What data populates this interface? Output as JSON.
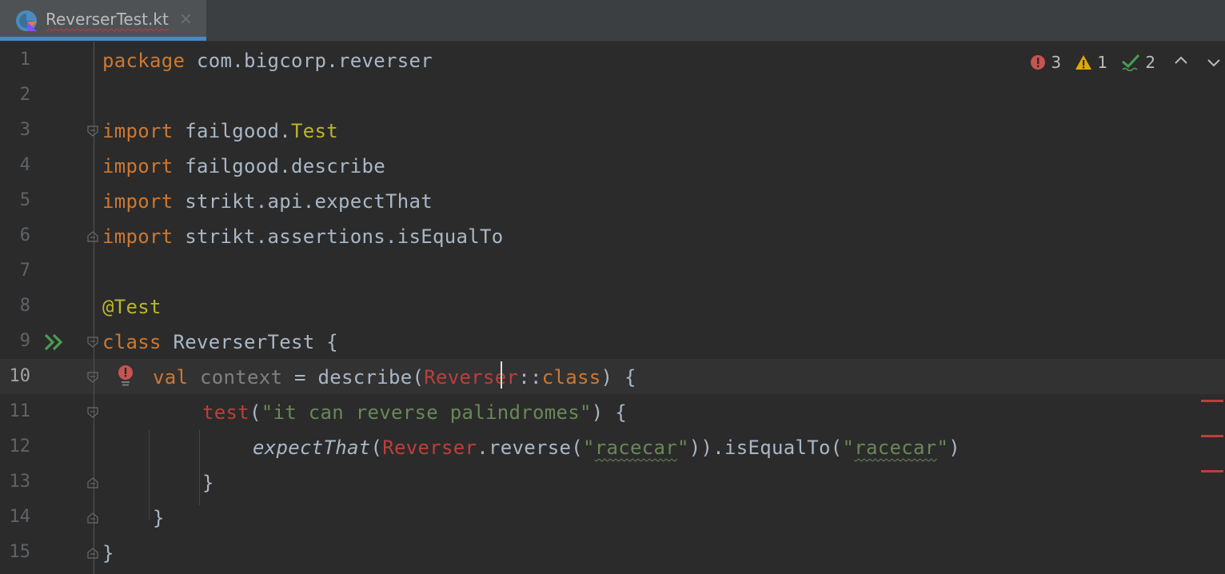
{
  "tab": {
    "title": "ReverserTest.kt",
    "close_glyph": "×",
    "icon": "kotlin-file-icon"
  },
  "inspections": {
    "errors": "3",
    "warnings": "1",
    "weak_warnings": "2",
    "error_color": "#bc3f3c",
    "warning_color": "#e0a800",
    "ok_color": "#499c54"
  },
  "editor": {
    "active_line": "10",
    "lines": [
      {
        "num": "1"
      },
      {
        "num": "2"
      },
      {
        "num": "3"
      },
      {
        "num": "4"
      },
      {
        "num": "5"
      },
      {
        "num": "6"
      },
      {
        "num": "7"
      },
      {
        "num": "8"
      },
      {
        "num": "9"
      },
      {
        "num": "10"
      },
      {
        "num": "11"
      },
      {
        "num": "12"
      },
      {
        "num": "13"
      },
      {
        "num": "14"
      },
      {
        "num": "15"
      }
    ],
    "code": {
      "l1_kw": "package",
      "l1_rest": " com.bigcorp.reverser",
      "l3_kw": "import",
      "l3_pkg": " failgood.",
      "l3_cls": "Test",
      "l4_kw": "import",
      "l4_rest": " failgood.describe",
      "l5_kw": "import",
      "l5_rest": " strikt.api.expectThat",
      "l6_kw": "import",
      "l6_rest": " strikt.assertions.isEqualTo",
      "l8_ann": "@Test",
      "l9_kw": "class",
      "l9_rest": " ReverserTest {",
      "l10_kw": "val",
      "l10_name": " context",
      "l10_op": " = describe(",
      "l10_ref": "Reverser",
      "l10_sep": "::",
      "l10_class": "class",
      "l10_end": ") {",
      "l11_fn": "test",
      "l11_open": "(",
      "l11_str": "\"it can reverse palindromes\"",
      "l11_end": ") {",
      "l12_fn": "expectThat",
      "l12_open": "(",
      "l12_ref": "Reverser",
      "l12_call": ".reverse(",
      "l12_q1": "\"",
      "l12_s1": "racecar",
      "l12_q2": "\"",
      "l12_mid": ")).isEqualTo(",
      "l12_q3": "\"",
      "l12_s2": "racecar",
      "l12_q4": "\"",
      "l12_end": ")",
      "l13": "}",
      "l14": "}",
      "l15": "}"
    },
    "gutter_icons": {
      "run": "run-test-icon",
      "error": "error-bulb-icon"
    }
  }
}
